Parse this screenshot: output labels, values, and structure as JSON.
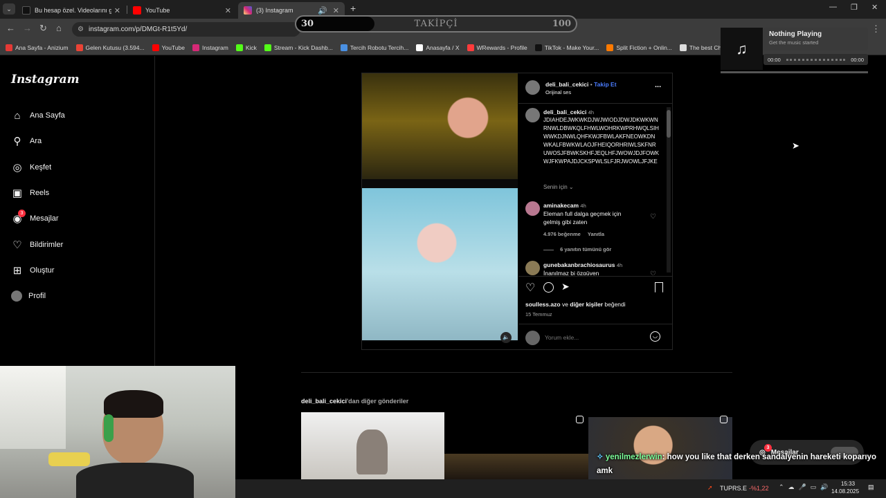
{
  "browser": {
    "tabs": [
      {
        "title": "Bu hesap özel. Videolarını görm",
        "active": false,
        "color": "#111111"
      },
      {
        "title": "YouTube",
        "active": false,
        "color": "#ff0000"
      },
      {
        "title": "(3) Instagram",
        "active": true,
        "color": "#d62976"
      }
    ],
    "new_tab": "+",
    "url": "instagram.com/p/DMGt-R1t5Yd/",
    "bookmarks": [
      {
        "label": "Ana Sayfa - Anizium",
        "color": "#e53935"
      },
      {
        "label": "Gelen Kutusu (3.594...",
        "color": "#ea4335"
      },
      {
        "label": "YouTube",
        "color": "#ff0000"
      },
      {
        "label": "Instagram",
        "color": "#d62976"
      },
      {
        "label": "Kick",
        "color": "#53fc18"
      },
      {
        "label": "Stream - Kick Dashb...",
        "color": "#53fc18"
      },
      {
        "label": "Tercih Robotu Tercih...",
        "color": "#4a90e2"
      },
      {
        "label": "Anasayfa / X",
        "color": "#ffffff"
      },
      {
        "label": "WRewards - Profile",
        "color": "#ff3b3b"
      },
      {
        "label": "TikTok - Make Your...",
        "color": "#111111"
      },
      {
        "label": "Split Fiction + Onlin...",
        "color": "#ff7a00"
      },
      {
        "label": "The best ChatBot an...",
        "color": "#dddddd"
      }
    ]
  },
  "overlay": {
    "left": "30",
    "title": "TAKİPÇİ",
    "right": "100",
    "progress": 0.28,
    "music": {
      "title": "Nothing Playing",
      "subtitle": "Get the music started",
      "time_start": "00:00",
      "time_end": "00:00"
    }
  },
  "instagram": {
    "logo": "Instagram",
    "nav": [
      {
        "label": "Ana Sayfa",
        "icon": "home-icon"
      },
      {
        "label": "Ara",
        "icon": "search-icon"
      },
      {
        "label": "Keşfet",
        "icon": "compass-icon"
      },
      {
        "label": "Reels",
        "icon": "reels-icon"
      },
      {
        "label": "Mesajlar",
        "icon": "messenger-icon",
        "badge": "3"
      },
      {
        "label": "Bildirimler",
        "icon": "heart-icon"
      },
      {
        "label": "Oluştur",
        "icon": "plus-square-icon"
      },
      {
        "label": "Profil",
        "icon": "avatar-icon"
      }
    ],
    "post": {
      "username": "deli_bali_cekici",
      "separator": "•",
      "follow": "Takip Et",
      "audio": "Orijinal ses",
      "more": "...",
      "caption_user": "deli_bali_cekici",
      "caption_time": "4h",
      "caption_text": "JDIAHDEJWKWKDJWJWIODJDWJDKWKWNRNWLDBWKQLFHWLWOHRKWPRHWQLSIHWWKDJNWLQHFKWJFBWLAKFNEOWKDNWKALFBWKWLAOJFHEIQORHRIWLSKFNRUWOSJFBWKSKHFJEQLHFJWOWJDJFOWKWJFKWPAJDJCKSPWLSLFJRJWOWLJFJKE",
      "senin_icin": "Senin için",
      "comments": [
        {
          "user": "aminakecam",
          "time": "4h",
          "text": "Eleman full dalga geçmek için gelmiş gibi zaten",
          "likes": "4.976 beğenme",
          "reply": "Yanıtla",
          "view": "6 yanıtın tümünü gör"
        },
        {
          "user": "gunebakanbrachiosaurus",
          "time": "4h",
          "text": "İnanılmaz bi özgüven"
        }
      ],
      "liked_by_user": "soulless.azo",
      "liked_by_join": "ve",
      "liked_by_others": "diğer kişiler",
      "liked_by_suffix": "beğendi",
      "date": "15 Temmuz",
      "comment_placeholder": "Yorum ekle..."
    },
    "more_posts_user": "deli_bali_cekici",
    "more_posts_suffix": "'dan diğer gönderiler",
    "messages_pill": "Mesajlar",
    "messages_badge": "3"
  },
  "stream_chat": {
    "user": "yenilmezlerwin",
    "text": ": how you like that derken sandalyenin hareketi koparıyo amk"
  },
  "taskbar": {
    "ticker": "TUPRS.E",
    "change": "-%1,22",
    "time": "15:33",
    "date": "14.08.2025"
  }
}
